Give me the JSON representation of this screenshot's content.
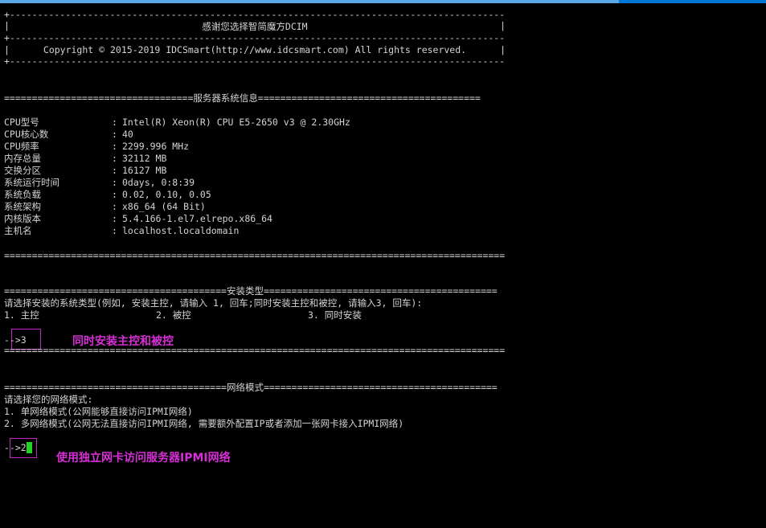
{
  "banner": {
    "border": "+--------------------------------------------------------------------------------------------+",
    "title": "感谢您选择智简魔方DCIM",
    "copyright": "Copyright © 2015-2019 IDCSmart(http://www.idcsmart.com) All rights reserved."
  },
  "sysinfo": {
    "header": "==================================服务器系统信息========================================",
    "footer": "==========================================================================================",
    "rows": [
      {
        "key": "CPU型号",
        "value": "Intel(R) Xeon(R) CPU E5-2650 v3 @ 2.30GHz"
      },
      {
        "key": "CPU核心数",
        "value": "40"
      },
      {
        "key": "CPU频率",
        "value": "2299.996 MHz"
      },
      {
        "key": "内存总量",
        "value": "32112 MB"
      },
      {
        "key": "交换分区",
        "value": "16127 MB"
      },
      {
        "key": "系统运行时间",
        "value": "0days, 0:8:39"
      },
      {
        "key": "系统负载",
        "value": "0.02, 0.10, 0.05"
      },
      {
        "key": "系统架构",
        "value": "x86_64 (64 Bit)"
      },
      {
        "key": "内核版本",
        "value": "5.4.166-1.el7.elrepo.x86_64"
      },
      {
        "key": "主机名",
        "value": "localhost.localdomain"
      }
    ]
  },
  "install": {
    "header": "========================================安装类型==========================================",
    "prompt": "请选择安装的系统类型(例如, 安装主控, 请输入 1, 回车;同时安装主控和被控, 请输入3, 回车):",
    "options": [
      "1. 主控",
      "2. 被控",
      "3. 同时安装"
    ],
    "input_prefix": "-->",
    "input_value": "3",
    "annotation": "同时安装主控和被控",
    "footer": "=========================================================================================="
  },
  "network": {
    "header": "========================================网络模式==========================================",
    "prompt": "请选择您的网络模式:",
    "option1": "1. 单网络模式(公网能够直接访问IPMI网络)",
    "option2": "2. 多网络模式(公网无法直接访问IPMI网络, 需要额外配置IP或者添加一张网卡接入IPMI网络)",
    "input_prefix": "-->",
    "input_value": "2",
    "annotation": "使用独立网卡访问服务器IPMI网络"
  },
  "colors": {
    "background": "#000000",
    "text": "#d4d4d4",
    "annotation": "#d62fd6",
    "cursor": "#23d323",
    "titlebar": "#0078d7"
  }
}
